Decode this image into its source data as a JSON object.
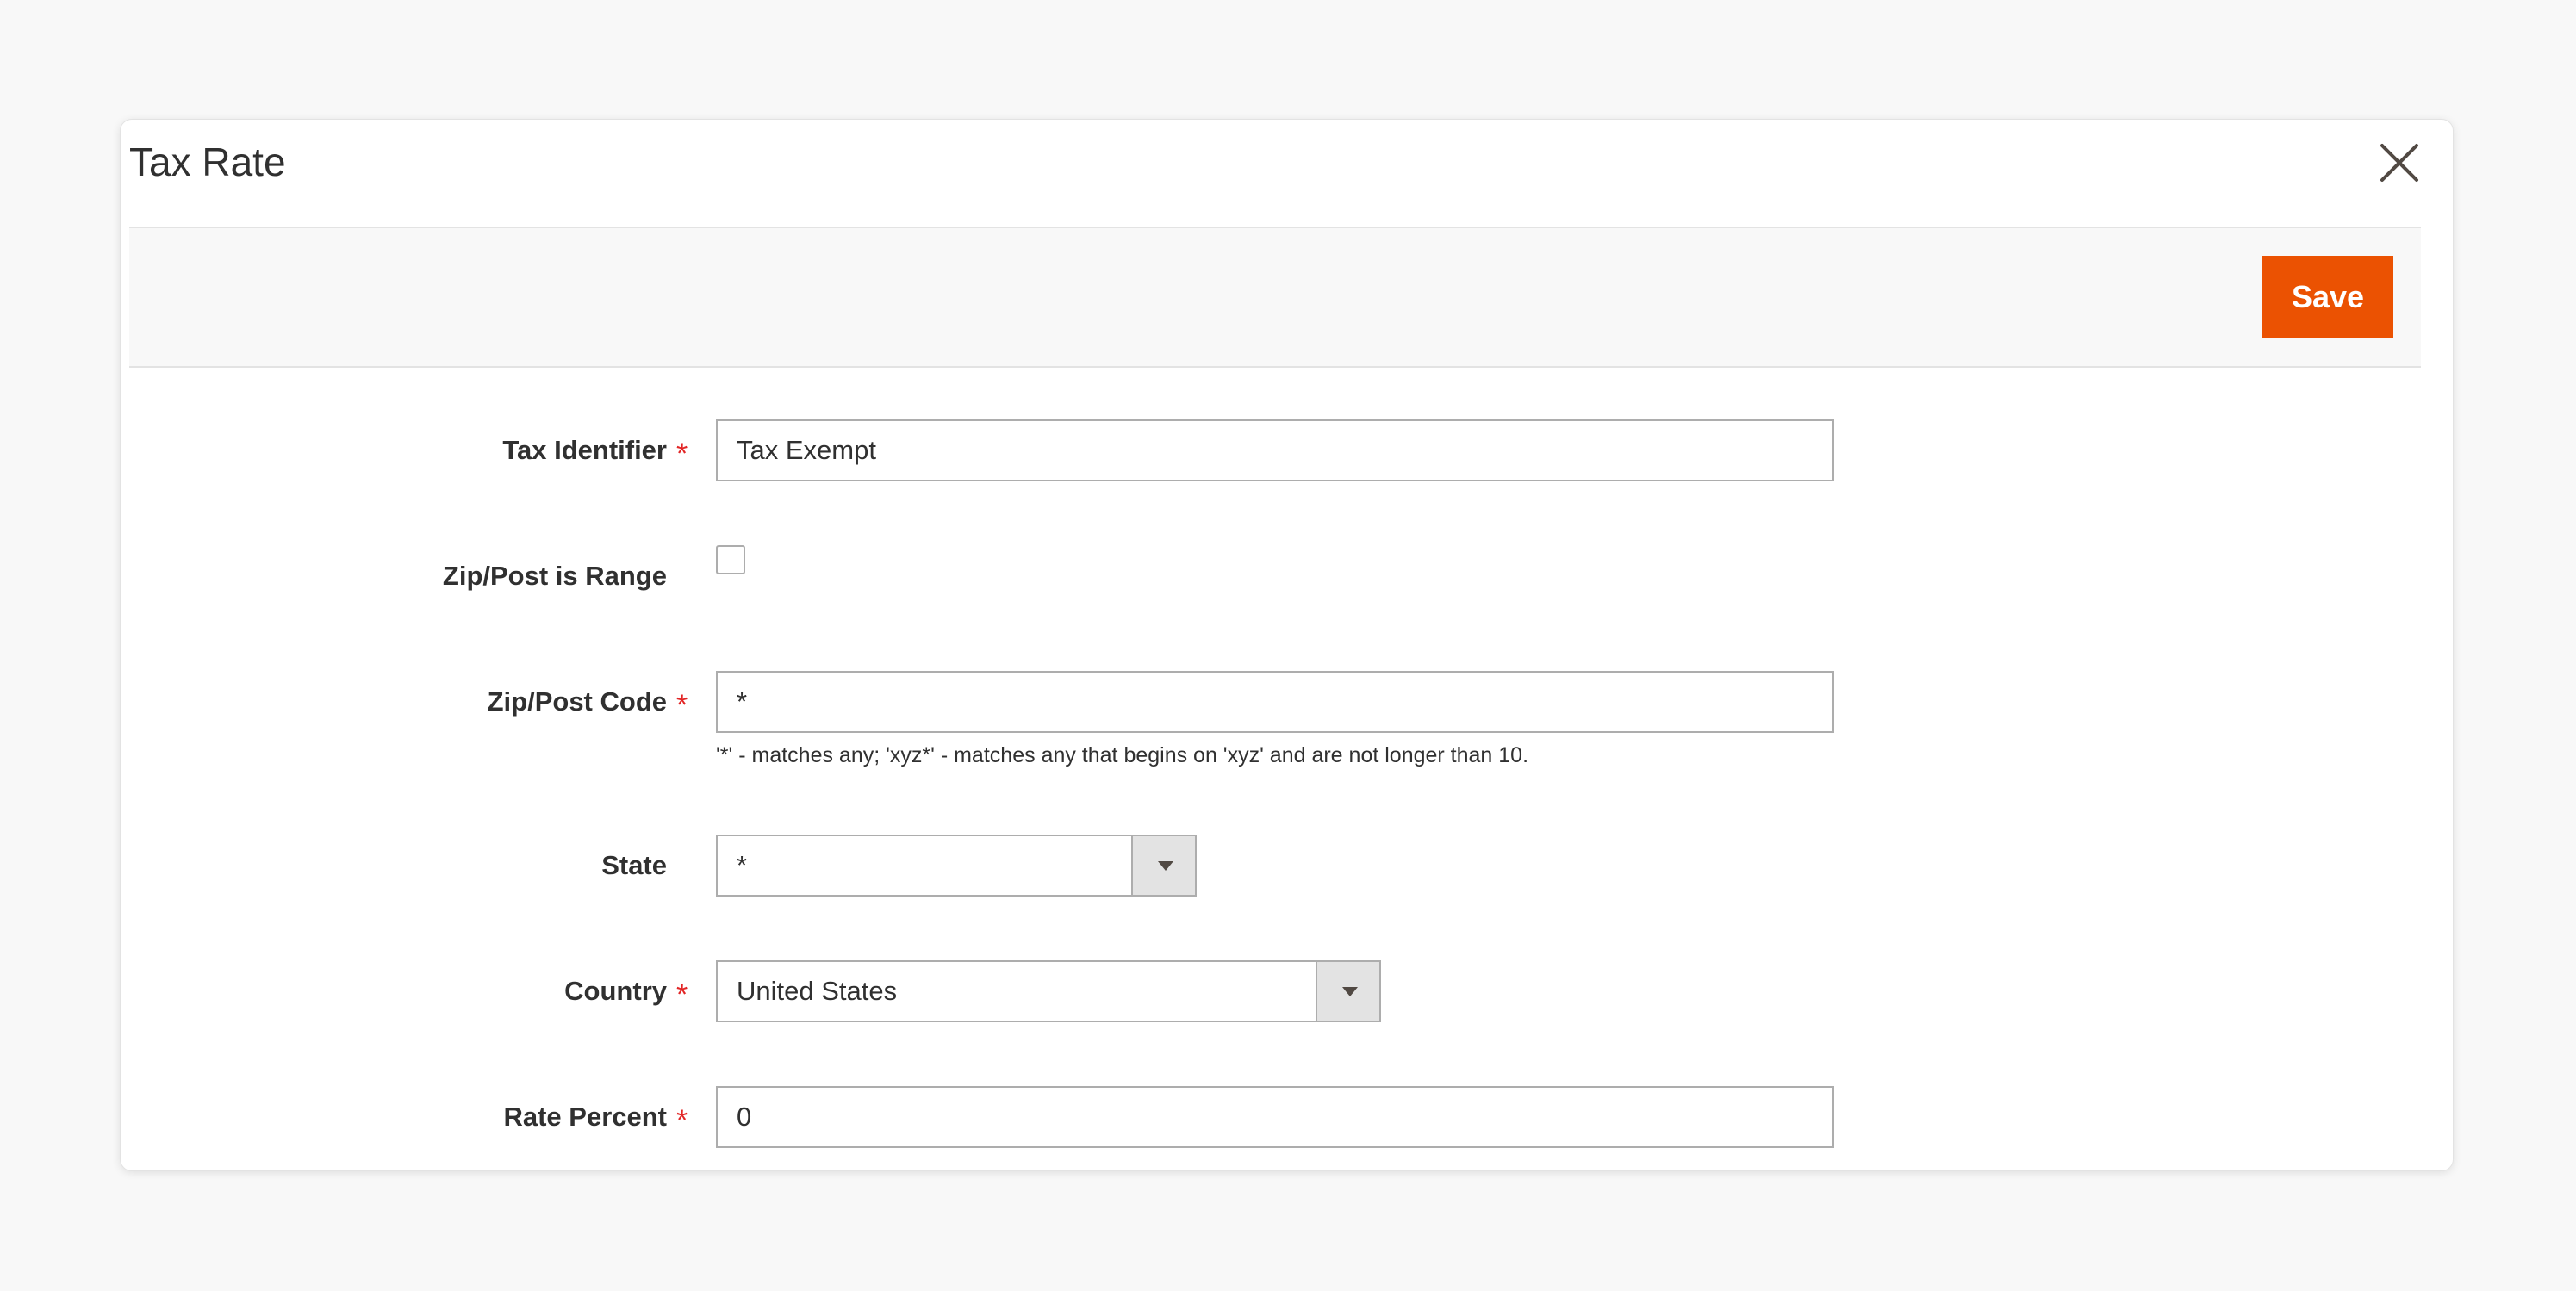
{
  "modal": {
    "title": "Tax Rate",
    "close_icon": "close-icon"
  },
  "actions": {
    "save_label": "Save"
  },
  "colors": {
    "accent": "#eb5202",
    "required": "#e22626",
    "panel_bg": "#f8f8f8",
    "border": "#adadad"
  },
  "form": {
    "tax_identifier": {
      "label": "Tax Identifier",
      "required": "*",
      "value": "Tax Exempt"
    },
    "zip_is_range": {
      "label": "Zip/Post is Range",
      "checked": false
    },
    "zip_code": {
      "label": "Zip/Post Code",
      "required": "*",
      "value": "*",
      "note": "'*' - matches any; 'xyz*' - matches any that begins on 'xyz' and are not longer than 10."
    },
    "state": {
      "label": "State",
      "value": "*"
    },
    "country": {
      "label": "Country",
      "required": "*",
      "value": "United States"
    },
    "rate_percent": {
      "label": "Rate Percent",
      "required": "*",
      "value": "0"
    }
  }
}
